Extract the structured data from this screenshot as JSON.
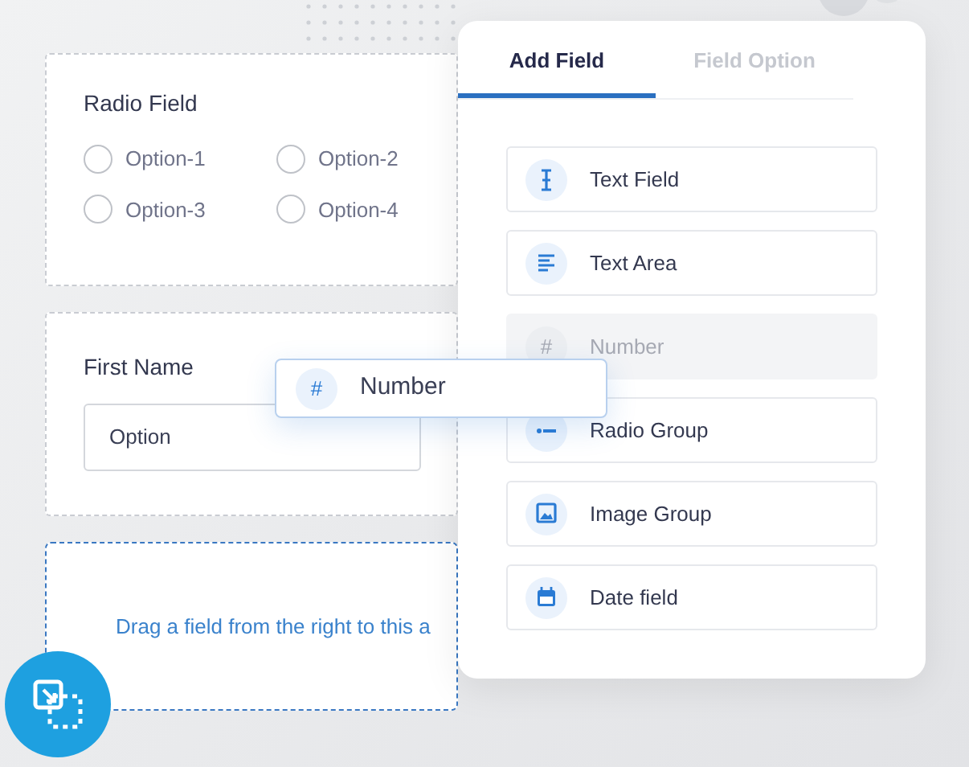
{
  "radio_card": {
    "label": "Radio Field",
    "options": [
      {
        "label": "Option-1",
        "selected": false
      },
      {
        "label": "Option-2",
        "selected": false
      },
      {
        "label": "Option-3",
        "selected": false
      },
      {
        "label": "Option-4",
        "selected": false
      }
    ]
  },
  "name_card": {
    "label": "First Name",
    "value": "Option"
  },
  "drop_zone": {
    "hint": "Drag a field from the right to this a"
  },
  "panel": {
    "tabs": [
      {
        "label": "Add Field",
        "selected": true
      },
      {
        "label": "Field Option",
        "selected": false
      }
    ],
    "fields": [
      {
        "kind": "text",
        "label": "Text Field",
        "disabled": false
      },
      {
        "kind": "textarea",
        "label": "Text Area",
        "disabled": false
      },
      {
        "kind": "number",
        "glyph": "#",
        "label": "Number",
        "disabled": true
      },
      {
        "kind": "radio",
        "label": "Radio Group",
        "disabled": false
      },
      {
        "kind": "image",
        "label": "Image Group",
        "disabled": false
      },
      {
        "kind": "date",
        "label": "Date field",
        "disabled": false
      }
    ]
  },
  "drag_chip": {
    "glyph": "#",
    "label": "Number"
  }
}
